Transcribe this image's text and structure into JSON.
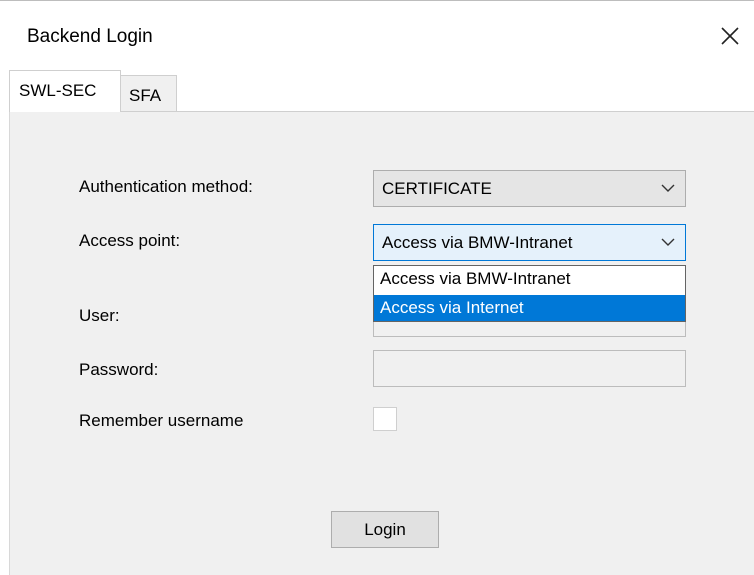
{
  "window": {
    "title": "Backend Login"
  },
  "tabs": [
    {
      "label": "SWL-SEC",
      "active": true
    },
    {
      "label": "SFA",
      "active": false
    }
  ],
  "form": {
    "auth_method": {
      "label": "Authentication method:",
      "value": "CERTIFICATE"
    },
    "access_point": {
      "label": "Access point:",
      "value": "Access via BMW-Intranet",
      "options": [
        "Access via BMW-Intranet",
        "Access via Internet"
      ],
      "highlighted": "Access via Internet"
    },
    "user": {
      "label": "User:",
      "value": ""
    },
    "password": {
      "label": "Password:",
      "value": ""
    },
    "remember": {
      "label": "Remember username",
      "checked": false
    }
  },
  "actions": {
    "login_label": "Login"
  },
  "colors": {
    "panel_bg": "#f0f0f0",
    "selection": "#0078d7",
    "focus_border": "#0078d7"
  }
}
